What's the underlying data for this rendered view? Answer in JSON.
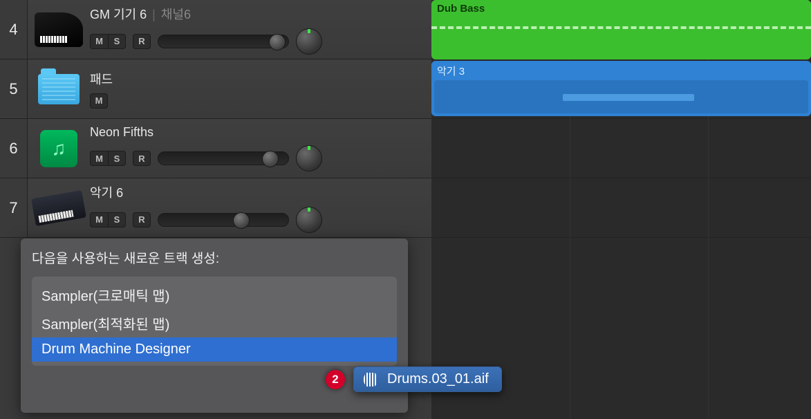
{
  "tracks": [
    {
      "num": "4",
      "name": "GM 기기 6",
      "channel": "채널6",
      "icon": "piano",
      "buttons": {
        "m": "M",
        "s": "S",
        "r": "R"
      },
      "hasSlider": true,
      "volPos": 160
    },
    {
      "num": "5",
      "name": "패드",
      "channel": "",
      "icon": "folder",
      "buttons": {
        "m": "M"
      },
      "hasSlider": false
    },
    {
      "num": "6",
      "name": "Neon Fifths",
      "channel": "",
      "icon": "note",
      "buttons": {
        "m": "M",
        "s": "S",
        "r": "R"
      },
      "hasSlider": true,
      "volPos": 150
    },
    {
      "num": "7",
      "name": "악기 6",
      "channel": "",
      "icon": "synth",
      "buttons": {
        "m": "M",
        "s": "S",
        "r": "R"
      },
      "hasSlider": true,
      "volPos": 108
    }
  ],
  "popup": {
    "title": "다음을 사용하는 새로운 트랙 생성:",
    "items": [
      {
        "label": "Sampler(크로매틱 맵)",
        "selected": false
      },
      {
        "label": "Sampler(최적화된 맵)",
        "selected": false
      },
      {
        "label": "Drum Machine Designer",
        "selected": true
      }
    ]
  },
  "drag": {
    "badge": "2",
    "filename": "Drums.03_01.aif"
  },
  "regions": {
    "green": {
      "label": "Dub Bass"
    },
    "blue": {
      "label": "악기 3",
      "noteLeft": 190,
      "noteWidth": 190
    }
  }
}
